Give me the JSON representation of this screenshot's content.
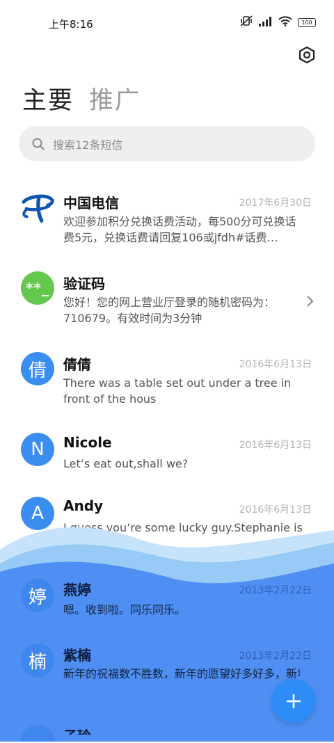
{
  "status": {
    "time": "上午8:16",
    "battery": "100"
  },
  "tabs": {
    "primary": "主要",
    "promo": "推广"
  },
  "search": {
    "placeholder": "搜索12条短信"
  },
  "colors": {
    "accent": "#2d8cf6",
    "avatar_blue": "#3a8ef0",
    "avatar_green": "#63c84d",
    "wave_top": "#bfe0fb",
    "wave_mid": "#8cc7f7",
    "wave_bottom": "#4d8ff3"
  },
  "messages": [
    {
      "name": "中国电信",
      "date": "2017年6月30日",
      "preview": "欢迎参加积分兑换话费活动，每500分可兑换话费5元，兑换话费请回复106或jfdh#话费…",
      "avatar_text": "",
      "avatar_icon": "china-telecom-logo-icon"
    },
    {
      "name": "验证码",
      "date": "",
      "preview": "您好！您的网上营业厅登录的随机密码为：710679。有效时间为3分钟",
      "avatar_text": "**_",
      "avatar_icon": "verification-code-icon"
    },
    {
      "name": "倩倩",
      "date": "2016年6月13日",
      "preview": "There was a table set out under a tree in front of the hous",
      "avatar_text": "倩"
    },
    {
      "name": "Nicole",
      "date": "2016年6月13日",
      "preview": "Let’s eat out,shall we?",
      "avatar_text": "N"
    },
    {
      "name": "Andy",
      "date": "2016年6月13日",
      "preview": "I guess you’re some lucky guy.Stephanie is a nice girl.",
      "avatar_text": "A"
    },
    {
      "name": "燕婷",
      "date": "2013年2月22日",
      "preview": "嗯。收到啦。同乐同乐。",
      "avatar_text": "婷"
    },
    {
      "name": "紫楠",
      "date": "2013年2月22日",
      "preview": "新年的祝福数不胜数，新年的愿望好多好多，新年的问候依旧美好，在这个温馨的时刻",
      "avatar_text": "楠"
    },
    {
      "name": "子玲",
      "date": "",
      "preview": "",
      "avatar_text": ""
    }
  ]
}
